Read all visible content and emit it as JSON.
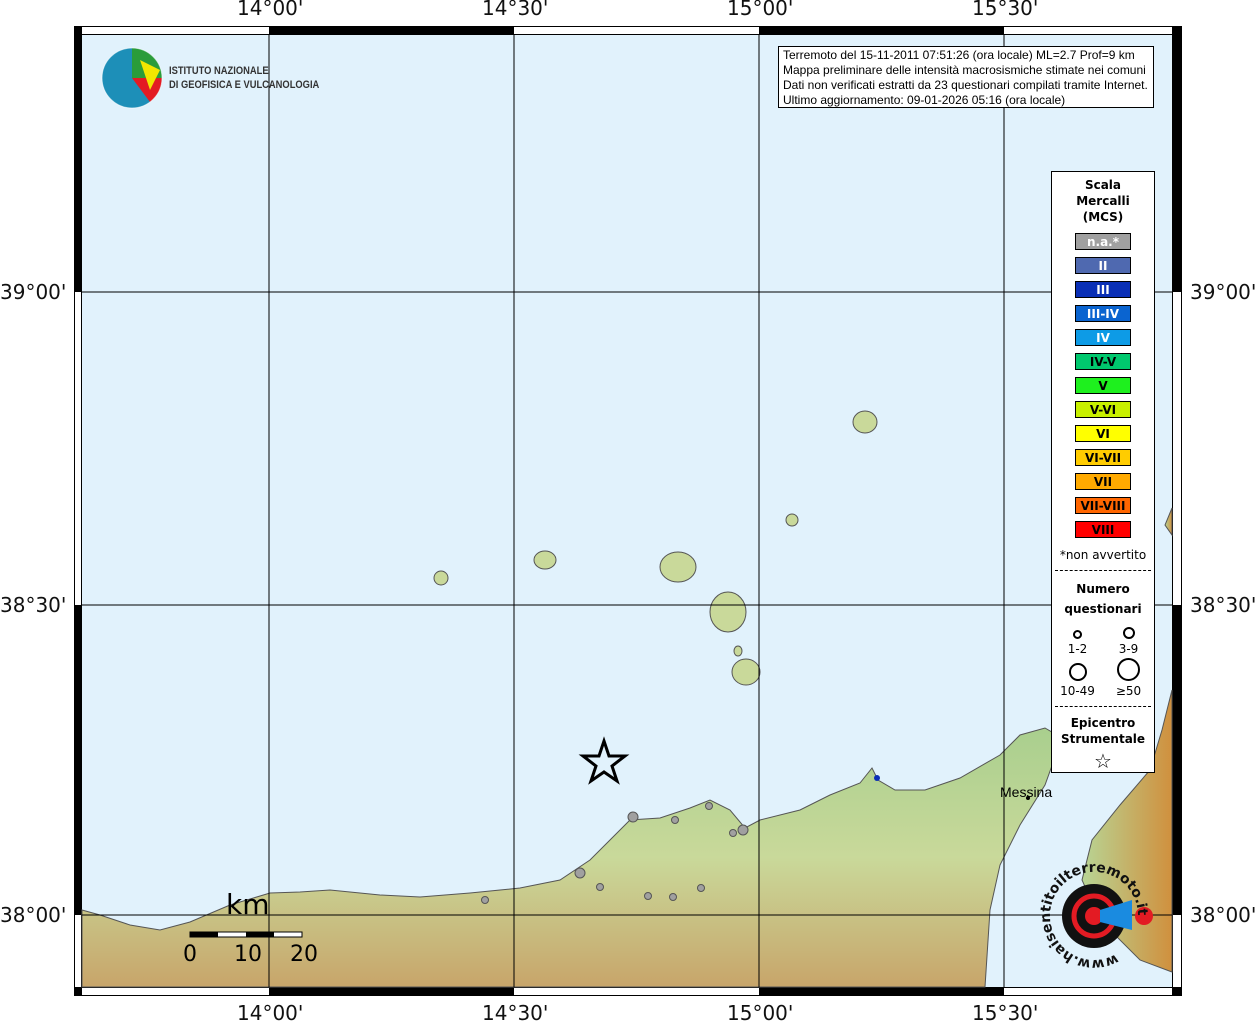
{
  "axes": {
    "lon_labels": [
      "14°00'",
      "14°30'",
      "15°00'",
      "15°30'"
    ],
    "lat_labels": [
      "39°00'",
      "38°30'",
      "38°00'"
    ]
  },
  "info": {
    "lines": [
      "Terremoto del 15-11-2011 07:51:26 (ora locale) ML=2.7 Prof=9 km",
      "Mappa preliminare delle intensità macrosismiche stimate nei comuni",
      "Dati non verificati estratti da 23 questionari compilati tramite Internet.",
      "Ultimo aggiornamento: 09-01-2026 05:16 (ora locale)"
    ]
  },
  "logo": {
    "line1": "ISTITUTO NAZIONALE",
    "line2": "DI GEOFISICA E VULCANOLOGIA"
  },
  "logo2": {
    "text": "www.haisentitoilterremoto.it"
  },
  "legend": {
    "title": [
      "Scala",
      "Mercalli",
      "(MCS)"
    ],
    "scale": [
      {
        "label": "n.a.*",
        "color": "#a0a0a0",
        "fg": "#fff"
      },
      {
        "label": "II",
        "color": "#4f69b0",
        "fg": "#fff"
      },
      {
        "label": "III",
        "color": "#0a2fb6",
        "fg": "#fff"
      },
      {
        "label": "III-IV",
        "color": "#0a64d0",
        "fg": "#fff"
      },
      {
        "label": "IV",
        "color": "#0d9be6",
        "fg": "#fff"
      },
      {
        "label": "IV-V",
        "color": "#00c86e",
        "fg": "#000"
      },
      {
        "label": "V",
        "color": "#1ef01e",
        "fg": "#000"
      },
      {
        "label": "V-VI",
        "color": "#c8f000",
        "fg": "#000"
      },
      {
        "label": "VI",
        "color": "#ffff00",
        "fg": "#000"
      },
      {
        "label": "VI-VII",
        "color": "#ffcc00",
        "fg": "#000"
      },
      {
        "label": "VII",
        "color": "#ffaa00",
        "fg": "#000"
      },
      {
        "label": "VII-VIII",
        "color": "#ff6600",
        "fg": "#000"
      },
      {
        "label": "VIII",
        "color": "#ff0000",
        "fg": "#000"
      }
    ],
    "na_note": "*non avvertito",
    "count_title": [
      "Numero",
      "questionari"
    ],
    "counts": [
      "1-2",
      "3-9",
      "10-49",
      "≥50"
    ],
    "epi_title": [
      "Epicentro",
      "Strumentale"
    ]
  },
  "scalebar": {
    "unit": "km",
    "ticks": [
      "0",
      "10",
      "20"
    ]
  },
  "places": {
    "messina": "Messina"
  },
  "colors": {
    "sea": "#e1f2fc",
    "na_point": "#a0a0a0",
    "blue_point": "#0a2fb6"
  }
}
